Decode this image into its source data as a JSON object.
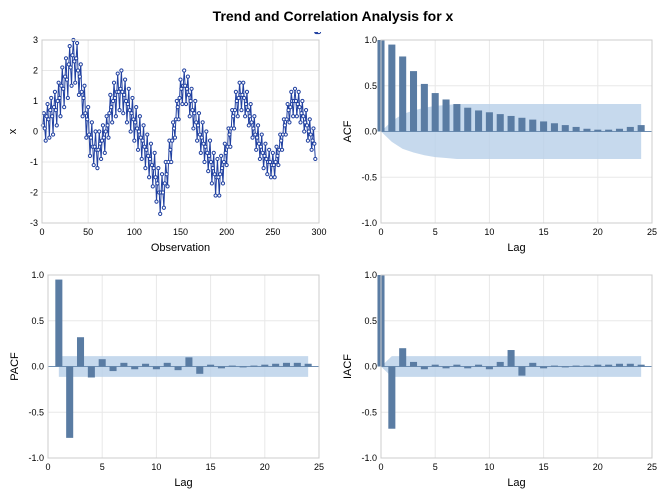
{
  "title": "Trend and Correlation Analysis for x",
  "chart_data": [
    {
      "type": "line",
      "name": "timeseries",
      "xlabel": "Observation",
      "ylabel": "x",
      "xlim": [
        0,
        300
      ],
      "ylim": [
        -3,
        3
      ],
      "xticks": [
        0,
        50,
        100,
        150,
        200,
        250,
        300
      ],
      "yticks": [
        -3,
        -2,
        -1,
        0,
        1,
        2,
        3
      ],
      "x": [
        1,
        2,
        3,
        4,
        5,
        6,
        7,
        8,
        9,
        10,
        11,
        12,
        13,
        14,
        15,
        16,
        17,
        18,
        19,
        20,
        21,
        22,
        23,
        24,
        25,
        26,
        27,
        28,
        29,
        30,
        31,
        32,
        33,
        34,
        35,
        36,
        37,
        38,
        39,
        40,
        41,
        42,
        43,
        44,
        45,
        46,
        47,
        48,
        49,
        50,
        51,
        52,
        53,
        54,
        55,
        56,
        57,
        58,
        59,
        60,
        61,
        62,
        63,
        64,
        65,
        66,
        67,
        68,
        69,
        70,
        71,
        72,
        73,
        74,
        75,
        76,
        77,
        78,
        79,
        80,
        81,
        82,
        83,
        84,
        85,
        86,
        87,
        88,
        89,
        90,
        91,
        92,
        93,
        94,
        95,
        96,
        97,
        98,
        99,
        100,
        101,
        102,
        103,
        104,
        105,
        106,
        107,
        108,
        109,
        110,
        111,
        112,
        113,
        114,
        115,
        116,
        117,
        118,
        119,
        120,
        121,
        122,
        123,
        124,
        125,
        126,
        127,
        128,
        129,
        130,
        131,
        132,
        133,
        134,
        135,
        136,
        137,
        138,
        139,
        140,
        141,
        142,
        143,
        144,
        145,
        146,
        147,
        148,
        149,
        150,
        151,
        152,
        153,
        154,
        155,
        156,
        157,
        158,
        159,
        160,
        161,
        162,
        163,
        164,
        165,
        166,
        167,
        168,
        169,
        170,
        171,
        172,
        173,
        174,
        175,
        176,
        177,
        178,
        179,
        180,
        181,
        182,
        183,
        184,
        185,
        186,
        187,
        188,
        189,
        190,
        191,
        192,
        193,
        194,
        195,
        196,
        197,
        198,
        199,
        200,
        201,
        202,
        203,
        204,
        205,
        206,
        207,
        208,
        209,
        210,
        211,
        212,
        213,
        214,
        215,
        216,
        217,
        218,
        219,
        220,
        221,
        222,
        223,
        224,
        225,
        226,
        227,
        228,
        229,
        230,
        231,
        232,
        233,
        234,
        235,
        236,
        237,
        238,
        239,
        240,
        241,
        242,
        243,
        244,
        245,
        246,
        247,
        248,
        249,
        250,
        251,
        252,
        253,
        254,
        255,
        256,
        257,
        258,
        259,
        260,
        261,
        262,
        263,
        264,
        265,
        266,
        267,
        268,
        269,
        270,
        271,
        272,
        273,
        274,
        275,
        276,
        277,
        278,
        279,
        280,
        281,
        282,
        283,
        284,
        285,
        286,
        287,
        288,
        289,
        290,
        291,
        292,
        293,
        294,
        295,
        296,
        297,
        298,
        299,
        300
      ],
      "values": [
        0.2,
        0.6,
        0.1,
        -0.3,
        0.5,
        0.9,
        0.4,
        -0.2,
        0.7,
        1.1,
        0.5,
        -0.1,
        0.8,
        1.3,
        0.7,
        0.2,
        1.0,
        1.6,
        1.1,
        0.5,
        1.5,
        2.1,
        1.4,
        0.8,
        1.8,
        2.4,
        1.7,
        1.1,
        2.2,
        2.8,
        2.1,
        1.5,
        2.5,
        3.0,
        2.3,
        1.6,
        2.4,
        2.9,
        2.0,
        1.2,
        1.8,
        2.2,
        1.3,
        0.5,
        1.1,
        1.5,
        0.6,
        -0.2,
        0.4,
        0.8,
        -0.1,
        -0.8,
        -0.2,
        0.3,
        -0.5,
        -1.1,
        -0.5,
        0.0,
        -0.6,
        -1.2,
        -0.6,
        0.0,
        -0.4,
        -0.9,
        -0.3,
        0.2,
        -0.2,
        -0.7,
        0.0,
        0.5,
        0.2,
        -0.2,
        0.6,
        1.2,
        0.8,
        0.3,
        1.0,
        1.6,
        1.1,
        0.5,
        1.3,
        1.9,
        1.3,
        0.7,
        1.4,
        2.0,
        1.3,
        0.6,
        1.2,
        1.7,
        1.0,
        0.3,
        0.9,
        1.4,
        0.7,
        0.0,
        0.6,
        1.1,
        0.4,
        -0.3,
        0.3,
        0.8,
        0.1,
        -0.6,
        0.0,
        0.5,
        -0.2,
        -0.9,
        -0.3,
        0.2,
        -0.5,
        -1.2,
        -0.6,
        -0.1,
        -0.8,
        -1.5,
        -0.9,
        -0.4,
        -1.1,
        -1.8,
        -1.2,
        -0.7,
        -1.5,
        -2.3,
        -1.7,
        -1.2,
        -2.0,
        -2.7,
        -2.0,
        -1.4,
        -2.0,
        -2.5,
        -1.7,
        -1.0,
        -1.4,
        -1.8,
        -1.0,
        -0.3,
        -0.6,
        -1.0,
        -0.3,
        0.3,
        0.1,
        -0.2,
        0.4,
        1.0,
        0.8,
        0.4,
        1.1,
        1.7,
        1.4,
        0.9,
        1.5,
        2.0,
        1.5,
        0.9,
        1.4,
        1.8,
        1.2,
        0.5,
        1.0,
        1.4,
        0.7,
        0.1,
        0.6,
        1.0,
        0.3,
        -0.3,
        0.2,
        0.6,
        -0.1,
        -0.7,
        -0.2,
        0.3,
        -0.4,
        -1.0,
        -0.5,
        0.0,
        -0.7,
        -1.3,
        -0.8,
        -0.3,
        -1.0,
        -1.7,
        -1.2,
        -0.7,
        -1.4,
        -2.1,
        -1.5,
        -0.9,
        -1.5,
        -2.1,
        -1.4,
        -0.8,
        -1.2,
        -1.7,
        -1.0,
        -0.4,
        -0.7,
        -1.1,
        -0.5,
        0.1,
        -0.1,
        -0.5,
        0.1,
        0.7,
        0.5,
        0.1,
        0.7,
        1.3,
        1.0,
        0.5,
        1.1,
        1.6,
        1.2,
        0.7,
        1.2,
        1.6,
        1.1,
        0.5,
        0.9,
        1.3,
        0.7,
        0.2,
        0.5,
        0.9,
        0.3,
        -0.2,
        0.1,
        0.5,
        -0.1,
        -0.6,
        -0.2,
        0.2,
        -0.4,
        -0.9,
        -0.5,
        -0.1,
        -0.7,
        -1.2,
        -0.8,
        -0.4,
        -0.9,
        -1.4,
        -1.0,
        -0.6,
        -1.0,
        -1.5,
        -1.1,
        -0.7,
        -1.1,
        -1.5,
        -1.0,
        -0.5,
        -0.8,
        -1.1,
        -0.6,
        -0.1,
        -0.3,
        -0.6,
        -0.1,
        0.4,
        0.2,
        -0.1,
        0.4,
        0.9,
        0.7,
        0.3,
        0.8,
        1.3,
        1.0,
        0.5,
        1.0,
        1.4,
        1.0,
        0.5,
        0.9,
        1.3,
        0.8,
        0.3,
        0.6,
        1.0,
        0.5,
        0.0,
        0.3,
        0.7,
        0.2,
        -0.3,
        0.0,
        0.4,
        -0.1,
        -0.6,
        -0.3,
        0.1,
        -0.4,
        -0.9
      ]
    },
    {
      "type": "bar",
      "name": "acf",
      "xlabel": "Lag",
      "ylabel": "ACF",
      "xlim": [
        0,
        25
      ],
      "ylim": [
        -1.0,
        1.0
      ],
      "xticks": [
        0,
        5,
        10,
        15,
        20,
        25
      ],
      "yticks": [
        -1.0,
        -0.5,
        0.0,
        0.5,
        1.0
      ],
      "categories": [
        0,
        1,
        2,
        3,
        4,
        5,
        6,
        7,
        8,
        9,
        10,
        11,
        12,
        13,
        14,
        15,
        16,
        17,
        18,
        19,
        20,
        21,
        22,
        23,
        24
      ],
      "values": [
        1.0,
        0.95,
        0.82,
        0.66,
        0.52,
        0.42,
        0.35,
        0.3,
        0.26,
        0.23,
        0.21,
        0.19,
        0.17,
        0.15,
        0.13,
        0.11,
        0.09,
        0.07,
        0.05,
        0.03,
        0.02,
        0.02,
        0.03,
        0.05,
        0.07
      ],
      "conf_upper": [
        0.0,
        0.113,
        0.19,
        0.23,
        0.26,
        0.28,
        0.29,
        0.3,
        0.3,
        0.3,
        0.3,
        0.3,
        0.3,
        0.3,
        0.3,
        0.3,
        0.3,
        0.3,
        0.3,
        0.3,
        0.3,
        0.3,
        0.3,
        0.3,
        0.3
      ],
      "conf_lower": [
        0.0,
        -0.113,
        -0.19,
        -0.23,
        -0.26,
        -0.28,
        -0.29,
        -0.3,
        -0.3,
        -0.3,
        -0.3,
        -0.3,
        -0.3,
        -0.3,
        -0.3,
        -0.3,
        -0.3,
        -0.3,
        -0.3,
        -0.3,
        -0.3,
        -0.3,
        -0.3,
        -0.3,
        -0.3
      ]
    },
    {
      "type": "bar",
      "name": "pacf",
      "xlabel": "Lag",
      "ylabel": "PACF",
      "xlim": [
        0,
        25
      ],
      "ylim": [
        -1.0,
        1.0
      ],
      "xticks": [
        0,
        5,
        10,
        15,
        20,
        25
      ],
      "yticks": [
        -1.0,
        -0.5,
        0.0,
        0.5,
        1.0
      ],
      "categories": [
        1,
        2,
        3,
        4,
        5,
        6,
        7,
        8,
        9,
        10,
        11,
        12,
        13,
        14,
        15,
        16,
        17,
        18,
        19,
        20,
        21,
        22,
        23,
        24
      ],
      "values": [
        0.95,
        -0.78,
        0.32,
        -0.12,
        0.08,
        -0.05,
        0.04,
        -0.03,
        0.03,
        -0.03,
        0.04,
        -0.04,
        0.1,
        -0.08,
        0.02,
        -0.02,
        0.01,
        -0.01,
        0.01,
        0.02,
        0.03,
        0.04,
        0.04,
        0.03
      ],
      "conf_upper": [
        0.113,
        0.113,
        0.113,
        0.113,
        0.113,
        0.113,
        0.113,
        0.113,
        0.113,
        0.113,
        0.113,
        0.113,
        0.113,
        0.113,
        0.113,
        0.113,
        0.113,
        0.113,
        0.113,
        0.113,
        0.113,
        0.113,
        0.113,
        0.113
      ],
      "conf_lower": [
        -0.113,
        -0.113,
        -0.113,
        -0.113,
        -0.113,
        -0.113,
        -0.113,
        -0.113,
        -0.113,
        -0.113,
        -0.113,
        -0.113,
        -0.113,
        -0.113,
        -0.113,
        -0.113,
        -0.113,
        -0.113,
        -0.113,
        -0.113,
        -0.113,
        -0.113,
        -0.113,
        -0.113
      ]
    },
    {
      "type": "bar",
      "name": "iacf",
      "xlabel": "Lag",
      "ylabel": "IACF",
      "xlim": [
        0,
        25
      ],
      "ylim": [
        -1.0,
        1.0
      ],
      "xticks": [
        0,
        5,
        10,
        15,
        20,
        25
      ],
      "yticks": [
        -1.0,
        -0.5,
        0.0,
        0.5,
        1.0
      ],
      "categories": [
        0,
        1,
        2,
        3,
        4,
        5,
        6,
        7,
        8,
        9,
        10,
        11,
        12,
        13,
        14,
        15,
        16,
        17,
        18,
        19,
        20,
        21,
        22,
        23,
        24
      ],
      "values": [
        1.0,
        -0.68,
        0.2,
        0.05,
        -0.03,
        0.02,
        -0.02,
        0.02,
        -0.02,
        0.02,
        -0.03,
        0.05,
        0.18,
        -0.1,
        0.04,
        -0.02,
        0.01,
        -0.01,
        0.01,
        0.01,
        0.02,
        0.02,
        0.03,
        0.03,
        0.02
      ],
      "conf_upper": [
        0.0,
        0.113,
        0.113,
        0.113,
        0.113,
        0.113,
        0.113,
        0.113,
        0.113,
        0.113,
        0.113,
        0.113,
        0.113,
        0.113,
        0.113,
        0.113,
        0.113,
        0.113,
        0.113,
        0.113,
        0.113,
        0.113,
        0.113,
        0.113,
        0.113
      ],
      "conf_lower": [
        0.0,
        -0.113,
        -0.113,
        -0.113,
        -0.113,
        -0.113,
        -0.113,
        -0.113,
        -0.113,
        -0.113,
        -0.113,
        -0.113,
        -0.113,
        -0.113,
        -0.113,
        -0.113,
        -0.113,
        -0.113,
        -0.113,
        -0.113,
        -0.113,
        -0.113,
        -0.113,
        -0.113,
        -0.113
      ]
    }
  ]
}
